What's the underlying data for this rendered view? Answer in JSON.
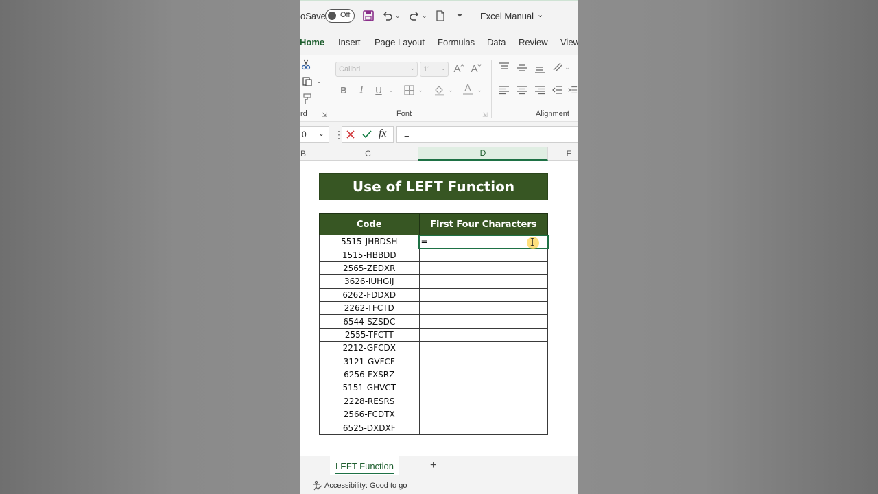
{
  "titlebar": {
    "autosave_label": "oSave",
    "autosave_state": "Off",
    "file_name": "Excel Manual"
  },
  "tabs": [
    "Home",
    "Insert",
    "Page Layout",
    "Formulas",
    "Data",
    "Review",
    "View"
  ],
  "active_tab": "Home",
  "ribbon": {
    "font_name": "Calibri",
    "font_size": "11",
    "clipboard_label": "rd",
    "font_group_label": "Font",
    "alignment_group_label": "Alignment"
  },
  "formula_bar": {
    "name_box": "0",
    "formula": "="
  },
  "columns": [
    "B",
    "C",
    "D",
    "E"
  ],
  "selected_column": "D",
  "sheet": {
    "title": "Use of LEFT Function",
    "headers": [
      "Code",
      "First Four Characters"
    ],
    "rows": [
      [
        "5515-JHBDSH",
        "="
      ],
      [
        "1515-HBBDD",
        ""
      ],
      [
        "2565-ZEDXR",
        ""
      ],
      [
        "3626-IUHGIJ",
        ""
      ],
      [
        "6262-FDDXD",
        ""
      ],
      [
        "2262-TFCTD",
        ""
      ],
      [
        "6544-SZSDC",
        ""
      ],
      [
        "2555-TFCTT",
        ""
      ],
      [
        "2212-GFCDX",
        ""
      ],
      [
        "3121-GVFCF",
        ""
      ],
      [
        "6256-FXSRZ",
        ""
      ],
      [
        "5151-GHVCT",
        ""
      ],
      [
        "2228-RESRS",
        ""
      ],
      [
        "2566-FCDTX",
        ""
      ],
      [
        "6525-DXDXF",
        ""
      ]
    ]
  },
  "sheet_tabs": [
    "LEFT Function"
  ],
  "status": {
    "accessibility": "Accessibility: Good to go"
  },
  "colors": {
    "header_green": "#375623",
    "accent_green": "#1e7145"
  },
  "icons": {
    "save": "save-icon",
    "undo": "undo-icon",
    "redo": "redo-icon",
    "cut": "scissors-icon",
    "copy": "copy-icon",
    "format_painter": "paintbrush-icon",
    "cancel": "x-icon",
    "enter": "check-icon",
    "fx": "fx-icon"
  }
}
